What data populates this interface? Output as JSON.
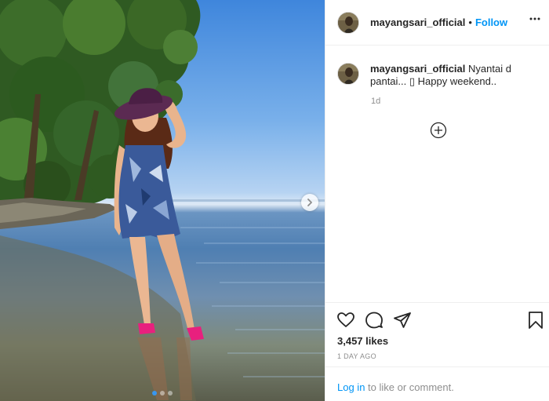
{
  "post": {
    "username": "mayangsari_official",
    "separator": "•",
    "follow_label": "Follow",
    "more_icon": "more-horizontal-icon"
  },
  "caption": {
    "username": "mayangsari_official",
    "text": "Nyantai d pantai... ▯ Happy weekend..",
    "time": "1d"
  },
  "media": {
    "image_count": 3,
    "active_index": 0,
    "next_icon": "chevron-right-icon"
  },
  "actions": {
    "icons": [
      "heart-icon",
      "comment-icon",
      "share-icon",
      "bookmark-icon"
    ],
    "likes": "3,457 likes",
    "date": "1 DAY AGO"
  },
  "login": {
    "link": "Log in",
    "rest": " to like or comment."
  },
  "colors": {
    "link_blue": "#0095f6",
    "dot_active": "#3897f0",
    "muted": "#8e8e8e"
  }
}
